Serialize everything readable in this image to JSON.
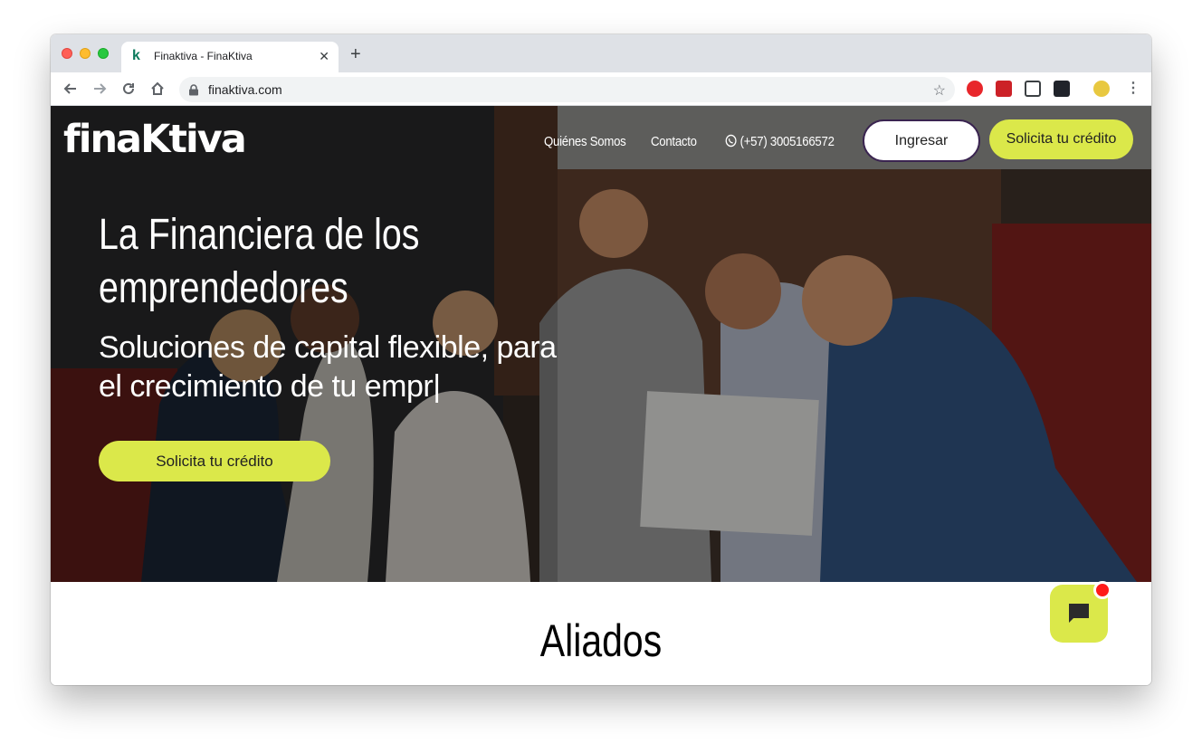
{
  "browser": {
    "tab_title": "Finaktiva - FinaKtiva",
    "tab_favicon": "k",
    "url": "finaktiva.com"
  },
  "site": {
    "logo_text": "finaKtiva",
    "nav": {
      "about": "Quiénes Somos",
      "contact": "Contacto",
      "phone": "(+57) 3005166572"
    },
    "login_label": "Ingresar",
    "apply_label": "Solicita tu crédito"
  },
  "hero": {
    "title_line1": "La Financiera de los",
    "title_line2": "emprendedores",
    "subtitle_line1": "Soluciones de capital flexible, para",
    "subtitle_line2": "el crecimiento de tu empr|",
    "cta_label": "Solicita tu crédito"
  },
  "section": {
    "aliados_title": "Aliados"
  },
  "colors": {
    "accent": "#dbe84a",
    "login_border": "#3a2450",
    "chat_badge": "#ff1a1a"
  },
  "icons": {
    "whatsapp": "whatsapp-icon",
    "chat": "chat-icon"
  }
}
